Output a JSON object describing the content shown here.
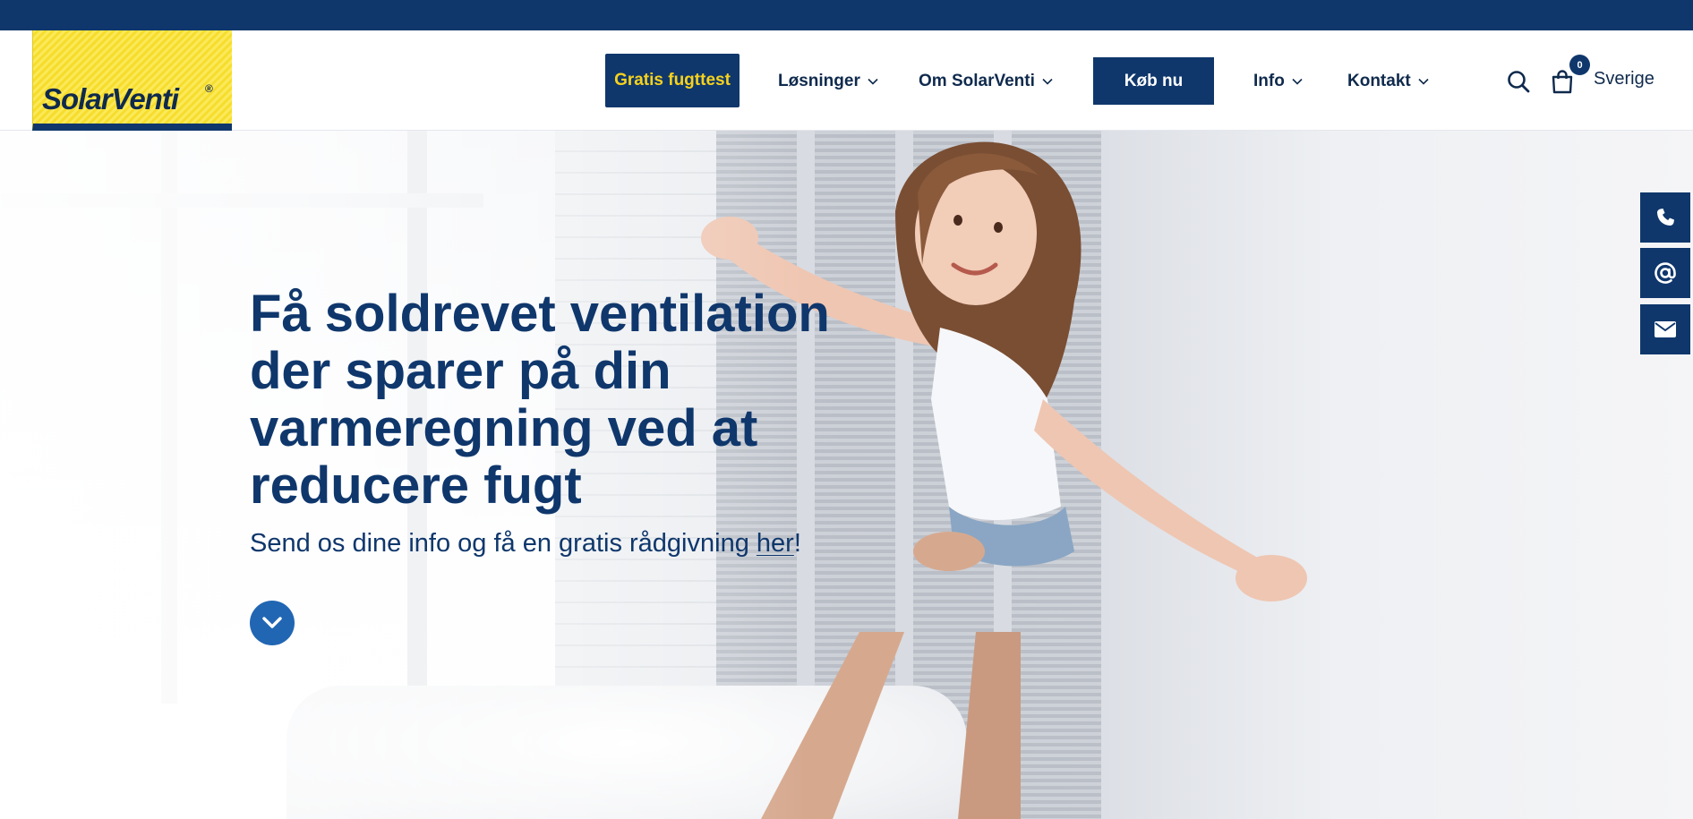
{
  "brand": {
    "logo_text": "SolarVenti",
    "logo_reg": "®"
  },
  "colors": {
    "primary": "#0f376c",
    "accent_yellow": "#f7d21c",
    "scroll_button": "#2166b3",
    "topbar": "#0f376c"
  },
  "nav": {
    "cta_free_test": "Gratis fugttest",
    "solutions": "Løsninger",
    "about": "Om SolarVenti",
    "buy_now": "Køb nu",
    "info": "Info",
    "contact": "Kontakt",
    "cart_count": "0",
    "country": "Sverige"
  },
  "icons": {
    "search": "search-icon",
    "cart": "shopping-bag-icon",
    "chevron": "chevron-down-icon",
    "phone": "phone-icon",
    "at": "at-icon",
    "mail": "envelope-icon",
    "scroll_down": "chevron-down-icon"
  },
  "hero": {
    "title": "Få soldrevet ventilation der sparer på din varmeregning ved at reducere fugt",
    "sub_prefix": "Send os dine info og få en gratis rådgivning ",
    "sub_link": "her",
    "sub_suffix": "!"
  }
}
